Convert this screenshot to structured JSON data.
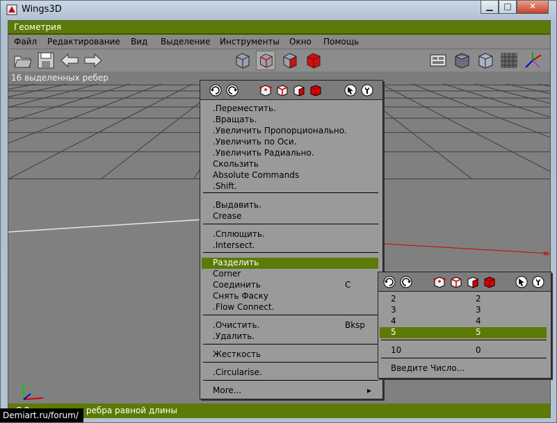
{
  "window": {
    "title": "Wings3D"
  },
  "header": {
    "title": "Геометрия"
  },
  "menubar": [
    {
      "label": "Файл"
    },
    {
      "label": "Редактирование"
    },
    {
      "label": "Вид"
    },
    {
      "label": "Выделение"
    },
    {
      "label": "Инструменты"
    },
    {
      "label": "Окно"
    },
    {
      "label": "Помощь"
    }
  ],
  "statusline": {
    "text": "16 выделенных ребер"
  },
  "footer": {
    "text": "Л Разделить на ребра равной длины"
  },
  "watermark": {
    "text": "Demiart.ru/forum/"
  },
  "colors": {
    "accent": "#5c7a06",
    "viewport": "#808080",
    "menu_bg": "#9a9a9a",
    "selection_red": "#d01010",
    "grid": "#3c3c3c"
  },
  "toolbar": {
    "icons": [
      "open-file-icon",
      "save-file-icon",
      "undo-arrow-icon",
      "redo-arrow-icon",
      "vertex-mode-icon",
      "edge-mode-icon",
      "face-mode-icon",
      "body-mode-icon",
      "workmode-icon",
      "smooth-shade-icon",
      "wireframe-icon",
      "ground-grid-icon",
      "axes-icon"
    ],
    "active_mode": "edge-mode-icon"
  },
  "context_menu": {
    "items": [
      {
        "label": ".Переместить.",
        "key": ""
      },
      {
        "label": ".Вращать.",
        "key": ""
      },
      {
        "label": ".Увеличить Пропорционально.",
        "key": ""
      },
      {
        "label": ".Увеличить по Оси.",
        "key": ""
      },
      {
        "label": ".Увеличить Радиально.",
        "key": ""
      },
      {
        "label": "Скользить",
        "key": ""
      },
      {
        "label": "Absolute Commands",
        "key": ""
      },
      {
        "label": ".Shift.",
        "key": ""
      },
      {
        "label": ".Выдавить.",
        "key": ""
      },
      {
        "label": "Crease",
        "key": ""
      },
      {
        "label": ".Сплющить.",
        "key": ""
      },
      {
        "label": ".Intersect.",
        "key": ""
      },
      {
        "label": "Разделить",
        "key": ""
      },
      {
        "label": "Corner",
        "key": ""
      },
      {
        "label": "Соединить",
        "key": "C"
      },
      {
        "label": "Снять Фаску",
        "key": ""
      },
      {
        "label": ".Flow Connect.",
        "key": ""
      },
      {
        "label": ".Очистить.",
        "key": "Bksp"
      },
      {
        "label": ".Удалить.",
        "key": ""
      },
      {
        "label": "Жесткость",
        "key": ""
      },
      {
        "label": ".Circularise.",
        "key": ""
      },
      {
        "label": "More...",
        "key": "▸"
      }
    ],
    "highlighted": "Разделить"
  },
  "submenu": {
    "rows": [
      {
        "left": "2",
        "right": "2"
      },
      {
        "left": "3",
        "right": "3"
      },
      {
        "left": "4",
        "right": "4"
      },
      {
        "left": "5",
        "right": "5"
      },
      {
        "left": "10",
        "right": "0"
      },
      {
        "left": "Введите Число...",
        "right": ""
      }
    ],
    "highlighted": "5"
  }
}
